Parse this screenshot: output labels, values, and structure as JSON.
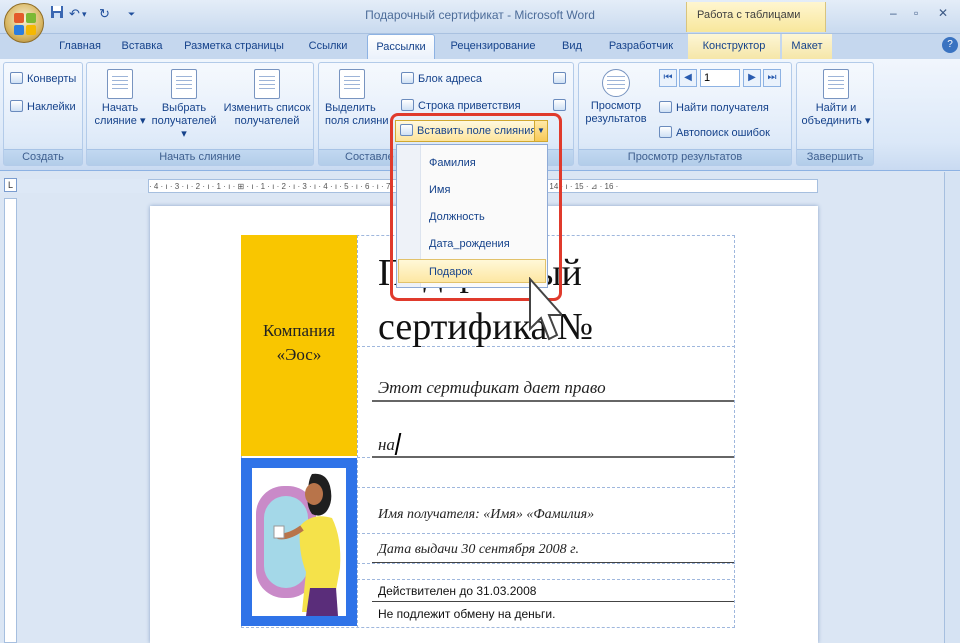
{
  "window": {
    "title": "Подарочный сертификат - Microsoft Word",
    "context_tab_group": "Работа с таблицами",
    "controls": {
      "minimize": "–",
      "restore": "▫",
      "close": "✕"
    }
  },
  "qat": {
    "save_icon": "save-icon",
    "undo": "↶",
    "undo_drop": "▾",
    "redo": "↻",
    "more": "⏷"
  },
  "tabs": [
    "Главная",
    "Вставка",
    "Разметка страницы",
    "Ссылки",
    "Рассылки",
    "Рецензирование",
    "Вид",
    "Разработчик",
    "Конструктор",
    "Макет"
  ],
  "active_tab": "Рассылки",
  "help": "?",
  "ribbon": {
    "create": {
      "label": "Создать",
      "envelopes": "Конверты",
      "labels": "Наклейки"
    },
    "start_merge": {
      "label": "Начать слияние",
      "start_line1": "Начать",
      "start_line2": "слияние ▾",
      "select_line1": "Выбрать",
      "select_line2": "получателей ▾",
      "edit_line1": "Изменить список",
      "edit_line2": "получателей"
    },
    "write_insert": {
      "label": "Составле",
      "highlight_line1": "Выделить",
      "highlight_line2": "поля слияни",
      "address_block": "Блок адреса",
      "greeting_line": "Строка приветствия"
    },
    "preview": {
      "label": "Просмотр результатов",
      "preview_line1": "Просмотр",
      "preview_line2": "результатов",
      "record": "1",
      "find_recipient": "Найти получателя",
      "auto_check": "Автопоиск ошибок"
    },
    "finish": {
      "label": "Завершить",
      "finish_line1": "Найти и",
      "finish_line2": "объединить ▾"
    }
  },
  "ruler": {
    "text": "· 4 · ı · 3 · ı · 2 · ı · 1 · ı · ⊞ · ı · 1 · ı · 2 · ı · 3 · ı · 4 · ı · 5 · ı · 6 · ı · 7 · ı · 8 · ı · 9 · ı · 10 · ı · 11 · ı · 12 · ı · 13 · ı · 14 · ı · 15 · ⊿ · 16 ·",
    "corner": "L"
  },
  "insert_field": {
    "label": "Вставить поле слияния",
    "arrow": "▼",
    "items": [
      "Фамилия",
      "Имя",
      "Должность",
      "Дата_рождения",
      "Подарок"
    ],
    "hovered_index": 4
  },
  "document": {
    "company_line1": "Компания",
    "company_line2": "«Эос»",
    "title_line1": "Подарочный",
    "title_line2": "сертифика  №",
    "entitles": "Этот сертификат дает право",
    "on": "на",
    "recipient": "Имя получателя:  «Имя» «Фамилия»",
    "issue_date": "Дата выдачи 30 сентября 2008 г.",
    "valid_until": "Действителен до 31.03.2008",
    "no_exchange": "Не подлежит обмену на деньги."
  },
  "colors": {
    "company_cell": "#f9c600",
    "image_cell": "#2f73e8",
    "highlight_frame": "#e03a2c",
    "menu_hover": "#fde7a3"
  }
}
